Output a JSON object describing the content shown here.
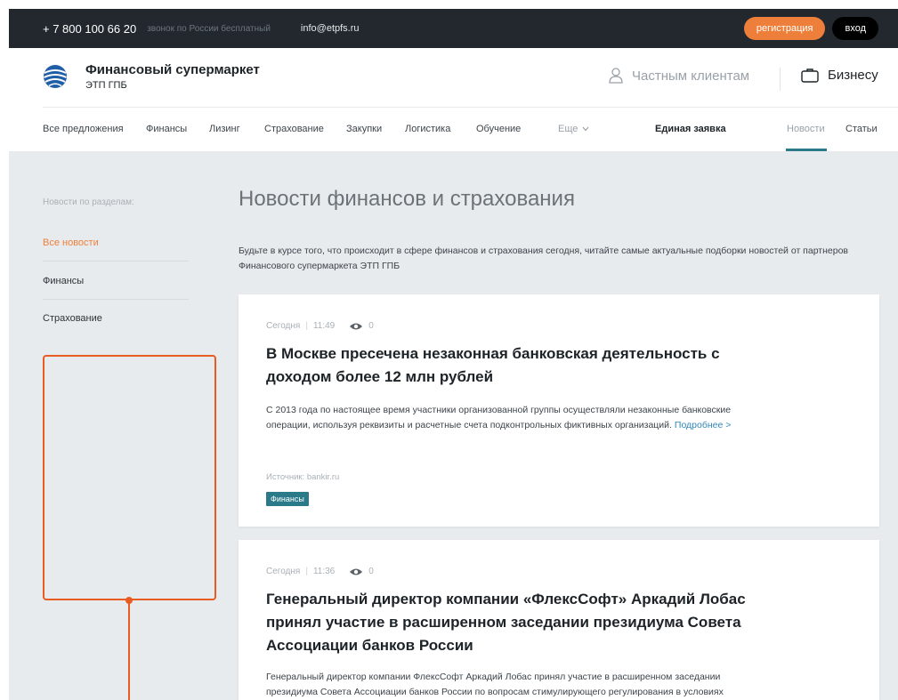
{
  "topbar": {
    "phone": "+ 7 800 100 66 20",
    "phone_note": "звонок по России бесплатный",
    "email": "info@etpfs.ru",
    "register_label": "регистрация",
    "login_label": "вход"
  },
  "header": {
    "brand_name": "Финансовый супермаркет",
    "brand_sub": "ЭТП ГПБ",
    "private_label": "Частным клиентам",
    "business_label": "Бизнесу"
  },
  "nav": {
    "items": [
      "Все предложения",
      "Финансы",
      "Лизинг",
      "Страхование",
      "Закупки",
      "Логистика",
      "Обучение"
    ],
    "more_label": "Еще",
    "unified_label": "Единая заявка",
    "news_label": "Новости",
    "articles_label": "Статьи"
  },
  "sidebar": {
    "title": "Новости по разделам:",
    "items": [
      "Все новости",
      "Финансы",
      "Страхование"
    ]
  },
  "main": {
    "title": "Новости финансов и страхования",
    "description": "Будьте в курсе того, что происходит в сфере финансов и страхования сегодня, читайте самые актуальные подборки новостей от партнеров Финансового супермаркета ЭТП ГПБ"
  },
  "news": [
    {
      "date": "Сегодня",
      "time": "11:49",
      "views": "0",
      "title": "В Москве пресечена незаконная банковская деятельность с доходом более 12 млн рублей",
      "text": "С 2013 года по настоящее время участники организованной группы осуществляли незаконные банковские операции, используя реквизиты и расчетные счета подконтрольных фиктивных организаций.",
      "more": "Подробнее >",
      "source": "Источник: bankir.ru",
      "tag": "Финансы"
    },
    {
      "date": "Сегодня",
      "time": "11:36",
      "views": "0",
      "title": "Генеральный директор компании «ФлексСофт» Аркадий Лобас принял участие в расширенном заседании президиума Совета Ассоциации банков России",
      "text": "Генеральный директор компании ФлексСофт Аркадий Лобас принял участие в расширенном заседании президиума Совета Ассоциации банков России по вопросам стимулирующего регулирования в условиях"
    }
  ],
  "colors": {
    "accent": "#ee7f3a",
    "teal": "#2b7a8a",
    "link": "#2f87b8",
    "highlight": "#e85c22"
  }
}
